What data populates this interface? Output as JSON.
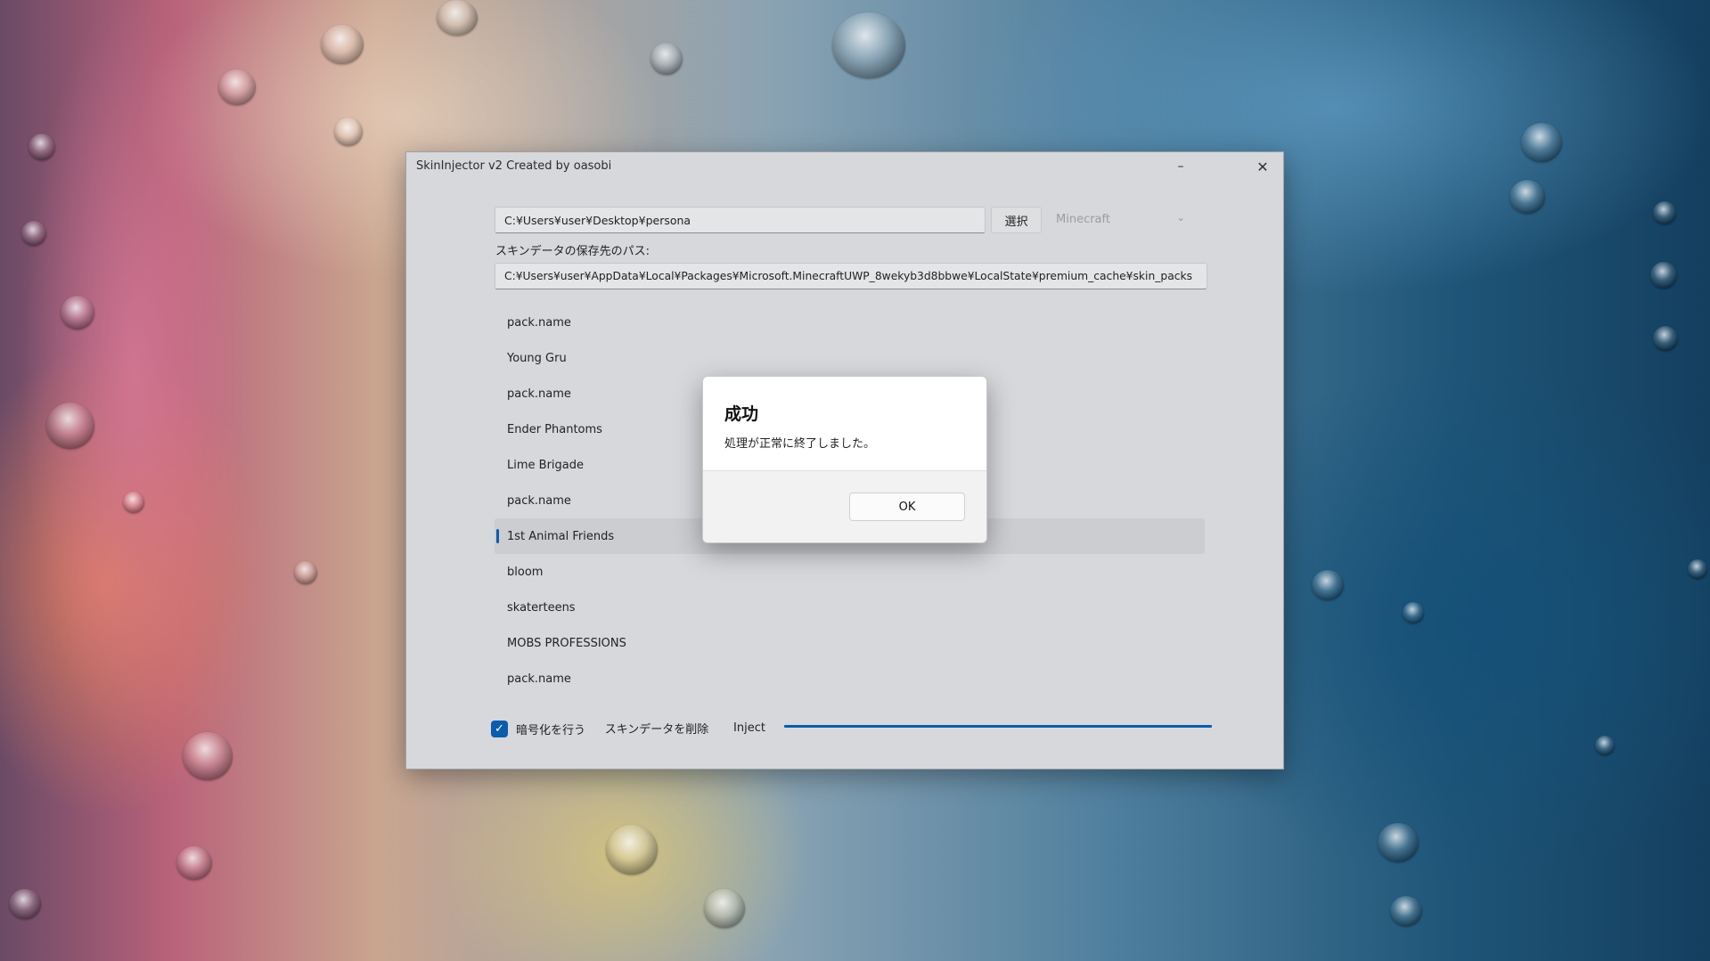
{
  "window": {
    "title": "SkinInjector v2 Created by oasobi",
    "minimize_glyph": "–",
    "close_glyph": "✕"
  },
  "form": {
    "source_path": "C:¥Users¥user¥Desktop¥persona",
    "select_button": "選択",
    "combo_value": "Minecraft",
    "combo_chevron": "⌄",
    "save_path_label": "スキンデータの保存先のパス:",
    "save_path": "C:¥Users¥user¥AppData¥Local¥Packages¥Microsoft.MinecraftUWP_8wekyb3d8bbwe¥LocalState¥premium_cache¥skin_packs"
  },
  "list": {
    "items": [
      {
        "label": "pack.name"
      },
      {
        "label": "Young Gru"
      },
      {
        "label": "pack.name"
      },
      {
        "label": "Ender Phantoms"
      },
      {
        "label": "Lime Brigade"
      },
      {
        "label": "pack.name"
      },
      {
        "label": "1st Animal Friends"
      },
      {
        "label": "bloom"
      },
      {
        "label": "skaterteens"
      },
      {
        "label": "MOBS PROFESSIONS"
      },
      {
        "label": "pack.name"
      }
    ],
    "selected_index": 6
  },
  "footer": {
    "checkbox_checked": true,
    "checkbox_glyph": "✓",
    "checkbox_label": "暗号化を行う",
    "delete_button": "スキンデータを削除",
    "inject_button": "Inject",
    "progress": 1.0
  },
  "dialog": {
    "title": "成功",
    "message": "処理が正常に終了しました。",
    "ok_button": "OK"
  },
  "colors": {
    "accent": "#0b5cad"
  }
}
